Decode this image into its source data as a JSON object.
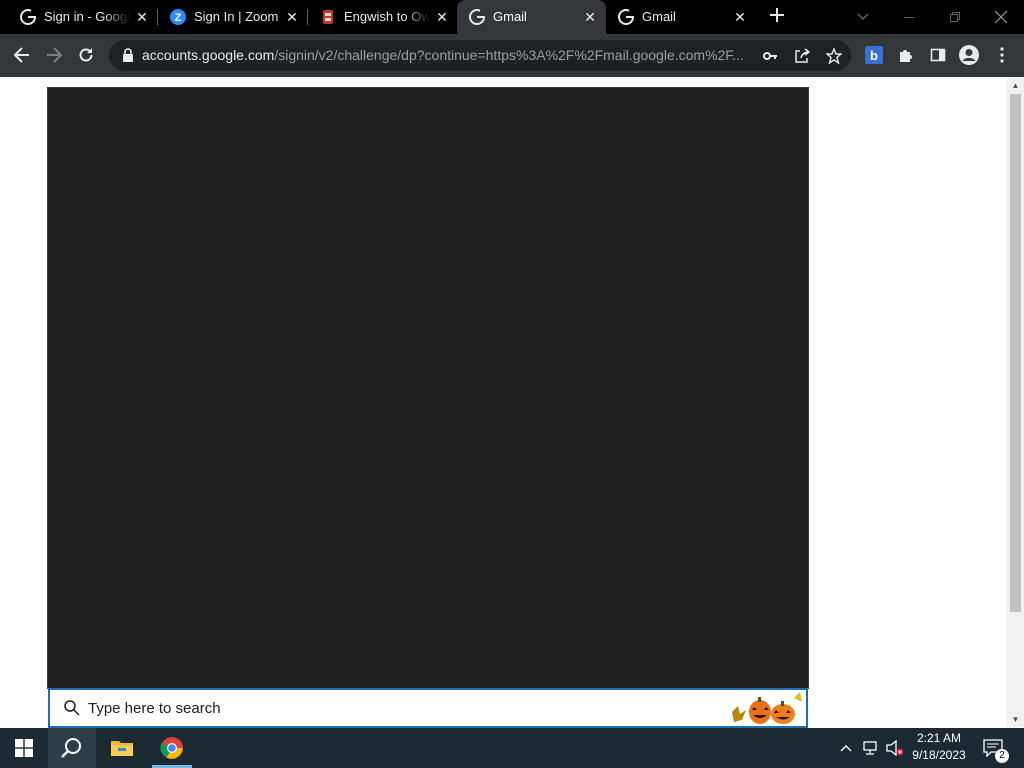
{
  "browser": {
    "tabs": [
      {
        "title": "Sign in - Google Accounts",
        "favicon": "google-g-icon",
        "active": false
      },
      {
        "title": "Sign In | Zoom",
        "favicon": "zoom-icon",
        "active": false
      },
      {
        "title": "Engwish to OwO",
        "favicon": "owo-app-icon",
        "active": false
      },
      {
        "title": "Gmail",
        "favicon": "google-g-icon",
        "active": true
      },
      {
        "title": "Gmail",
        "favicon": "google-g-icon",
        "active": false
      }
    ],
    "omnibox": {
      "host": "accounts.google.com",
      "path": "/signin/v2/challenge/dp?continue=https%3A%2F%2Fmail.google.com%2F..."
    }
  },
  "start_menu": {
    "search_placeholder": "Type here to search"
  },
  "taskbar": {
    "clock_time": "2:21 AM",
    "clock_date": "9/18/2023",
    "notification_count": "2"
  },
  "colors": {
    "tabstrip": "#000000",
    "toolbar": "#35363a",
    "omnibox": "#202124",
    "start_menu": "#202020",
    "search_border": "#1f6fb5",
    "taskbar": "#1c2a33"
  }
}
